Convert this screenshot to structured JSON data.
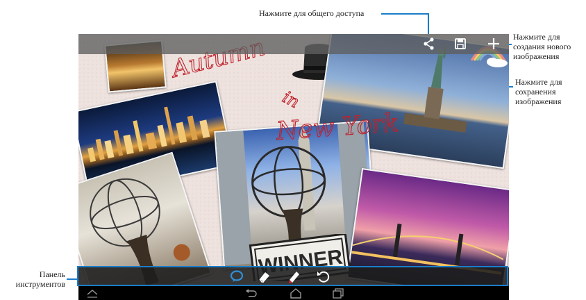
{
  "callouts": {
    "share": "Нажмите для общего доступа",
    "new_image": [
      "Нажмите для",
      "создания нового",
      "изображения"
    ],
    "save_image": [
      "Нажмите для",
      "сохранения",
      "изображения"
    ],
    "toolbar": [
      "Панель",
      "инструментов"
    ]
  },
  "canvas": {
    "handwriting": [
      "Autumn",
      "in",
      "New York"
    ],
    "sign_text": "WINNER"
  },
  "topbar": {
    "icons": [
      "share-icon",
      "save-icon",
      "add-icon"
    ]
  },
  "toolbar": {
    "icons": [
      "sticker-icon",
      "eraser-icon",
      "pen-icon",
      "undo-icon"
    ]
  },
  "navbar": {
    "icons": [
      "chevron-up-icon",
      "back-icon",
      "home-icon",
      "recent-apps-icon"
    ]
  },
  "colors": {
    "accent": "#1a7dc9",
    "ink": "#c0202a",
    "sticker": "#2f8fd8"
  }
}
